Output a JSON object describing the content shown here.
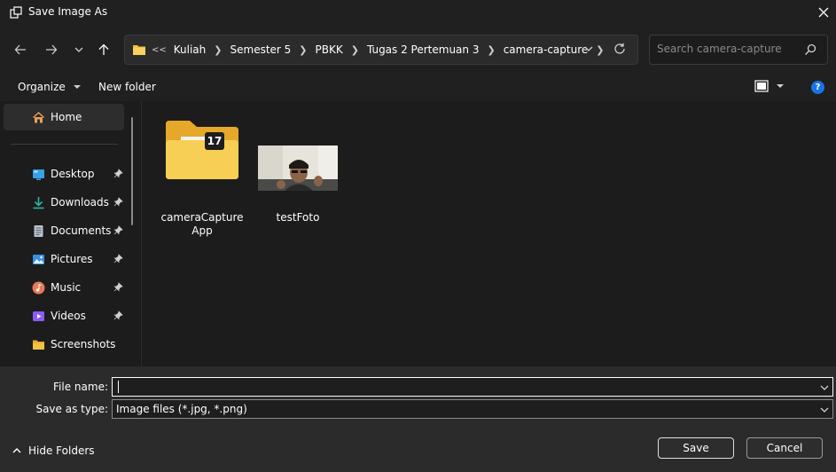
{
  "window": {
    "title": "Save Image As"
  },
  "address": {
    "overflow": "<<",
    "crumbs": [
      "Kuliah",
      "Semester 5",
      "PBKK",
      "Tugas 2 Pertemuan 3",
      "camera-capture"
    ]
  },
  "search": {
    "placeholder": "Search camera-capture"
  },
  "commands": {
    "organize": "Organize",
    "new_folder": "New folder",
    "help": "?"
  },
  "sidebar": {
    "home": "Home",
    "items": [
      {
        "label": "Desktop",
        "icon": "desktop-icon",
        "color": "#3aa0e6"
      },
      {
        "label": "Downloads",
        "icon": "download-icon",
        "color": "#2db5a3"
      },
      {
        "label": "Documents",
        "icon": "document-icon",
        "color": "#b9c2cc"
      },
      {
        "label": "Pictures",
        "icon": "pictures-icon",
        "color": "#3b8fe0"
      },
      {
        "label": "Music",
        "icon": "music-icon",
        "color": "#e8785a"
      },
      {
        "label": "Videos",
        "icon": "videos-icon",
        "color": "#8b5cf6"
      },
      {
        "label": "Screenshots",
        "icon": "folder-icon",
        "color": "#f4c242"
      }
    ]
  },
  "files": [
    {
      "name": "cameraCaptureApp",
      "type": "folder",
      "badge": "17"
    },
    {
      "name": "testFoto",
      "type": "image"
    }
  ],
  "form": {
    "file_name_label": "File name:",
    "file_name_value": "",
    "save_type_label": "Save as type:",
    "save_type_value": "Image files (*.jpg, *.png)"
  },
  "footer": {
    "hide_folders": "Hide Folders",
    "save": "Save",
    "cancel": "Cancel"
  },
  "colors": {
    "accent": "#1a73e8",
    "background": "#202020",
    "folder": "#f4c242"
  }
}
